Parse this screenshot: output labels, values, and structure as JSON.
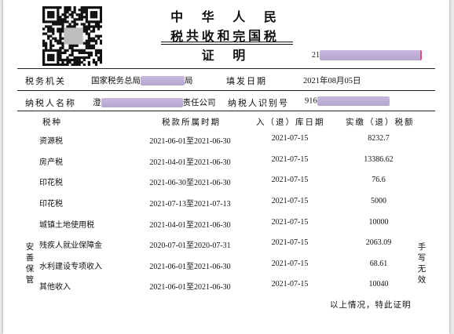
{
  "document": {
    "title_line1": "中 华 人 民 共 和 国",
    "title_line2": "税 收 完 税 证 明",
    "cert_no_prefix": "21",
    "issuer_label": "税务机关",
    "issuer_value_prefix": "国家税务总局",
    "issuer_value_suffix": "局",
    "fill_date_label": "填发日期",
    "fill_date_value": "2021年08月05日",
    "taxpayer_name_label": "纳税人名称",
    "taxpayer_name_prefix": "澄",
    "taxpayer_name_suffix": "责任公司",
    "taxpayer_id_label": "纳税人识别号",
    "taxpayer_id_prefix": "916"
  },
  "table": {
    "headers": [
      "税种",
      "税款所属时期",
      "入（退）库日期",
      "实缴（退）税额"
    ],
    "rows": [
      {
        "tax_type": "资源税",
        "period": "2021-06-01至2021-06-30",
        "date": "2021-07-15",
        "amount": "8232.7"
      },
      {
        "tax_type": "房产税",
        "period": "2021-04-01至2021-06-30",
        "date": "2021-07-15",
        "amount": "13386.62"
      },
      {
        "tax_type": "印花税",
        "period": "2021-06-30至2021-06-30",
        "date": "2021-07-15",
        "amount": "76.6"
      },
      {
        "tax_type": "印花税",
        "period": "2021-07-13至2021-07-13",
        "date": "2021-07-15",
        "amount": "5000"
      },
      {
        "tax_type": "城镇土地使用税",
        "period": "2021-04-01至2021-06-30",
        "date": "2021-07-15",
        "amount": "10000"
      },
      {
        "tax_type": "残疾人就业保障金",
        "period": "2020-07-01至2020-07-31",
        "date": "2021-07-15",
        "amount": "2063.09"
      },
      {
        "tax_type": "水利建设专项收入",
        "period": "2021-06-01至2021-06-30",
        "date": "2021-07-15",
        "amount": "68.61"
      },
      {
        "tax_type": "其他收入",
        "period": "2021-06-01至2021-06-30",
        "date": "2021-07-15",
        "amount": "10040"
      }
    ]
  },
  "side_notes": {
    "left": [
      "安",
      "善",
      "保",
      "管"
    ],
    "right": [
      "手",
      "写",
      "无",
      "效"
    ]
  },
  "footer": "以上情况，特此证明"
}
